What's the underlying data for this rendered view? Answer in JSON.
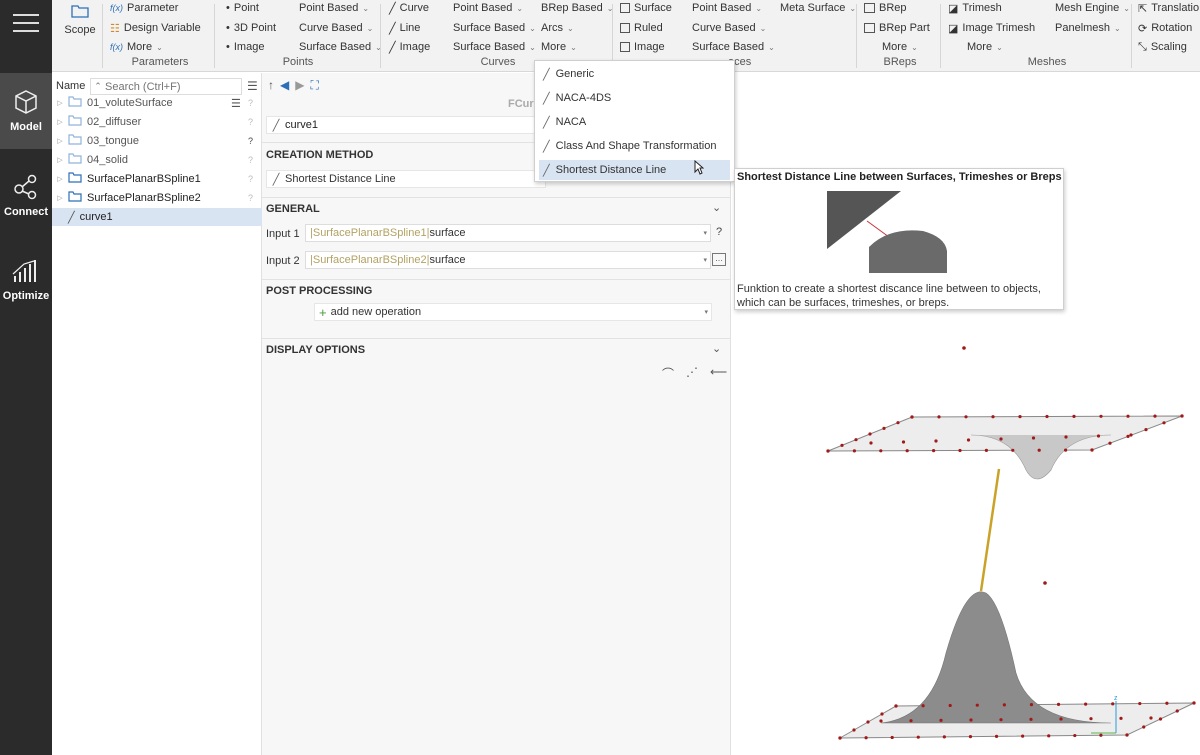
{
  "rail": {
    "items": [
      {
        "label": "Model",
        "icon": "cube-icon",
        "active": true
      },
      {
        "label": "Connect",
        "icon": "share-nodes-icon"
      },
      {
        "label": "Optimize",
        "icon": "bar-chart-icon"
      }
    ]
  },
  "ribbon": {
    "scope": "Scope",
    "parameters": {
      "items": [
        "Parameter",
        "Design Variable",
        "More"
      ],
      "group": "Parameters"
    },
    "points": {
      "col1": [
        "Point",
        "3D Point",
        "Image"
      ],
      "col2": [
        "Point Based",
        "Curve Based",
        "Surface Based"
      ],
      "group": "Points"
    },
    "curves": {
      "col1": [
        "Curve",
        "Line",
        "Image"
      ],
      "col2": [
        "Point Based",
        "Surface Based",
        "Surface Based"
      ],
      "col3": [
        "BRep Based",
        "Arcs",
        "More"
      ],
      "group": "Curves"
    },
    "surfaces": {
      "col1": [
        "Surface",
        "Ruled",
        "Image"
      ],
      "col2": [
        "Point Based",
        "Curve Based",
        "Surface Based"
      ],
      "col3": [
        "Meta Surface"
      ],
      "group": "aces"
    },
    "breps": {
      "items": [
        "BRep",
        "BRep Part",
        "More"
      ],
      "group": "BReps"
    },
    "meshes": {
      "col1": [
        "Trimesh",
        "Image Trimesh",
        "More"
      ],
      "col2": [
        "Mesh Engine",
        "Panelmesh"
      ],
      "group": "Meshes"
    },
    "transforms": {
      "items": [
        "Translatio",
        "Rotation",
        "Scaling"
      ]
    }
  },
  "tree": {
    "column": "Name",
    "search_placeholder": "Search (Ctrl+F)",
    "items": [
      {
        "label": "01_voluteSurface",
        "type": "folder"
      },
      {
        "label": "02_diffuser",
        "type": "folder"
      },
      {
        "label": "03_tongue",
        "type": "folder"
      },
      {
        "label": "04_solid",
        "type": "folder"
      },
      {
        "label": "SurfacePlanarBSpline1",
        "type": "folder-dark"
      },
      {
        "label": "SurfacePlanarBSpline2",
        "type": "folder-dark"
      },
      {
        "label": "curve1",
        "type": "curve",
        "selected": true
      }
    ]
  },
  "editor": {
    "type_label": "FCur",
    "name_value": "curve1",
    "creation_method_title": "CREATION METHOD",
    "creation_method_value": "Shortest Distance Line",
    "general_title": "GENERAL",
    "input1_label": "Input 1",
    "input1_ref": "|SurfacePlanarBSpline1|",
    "input1_val": "surface",
    "input2_label": "Input 2",
    "input2_ref": "|SurfacePlanarBSpline2|",
    "input2_val": "surface",
    "post_title": "POST PROCESSING",
    "add_operation": "add new operation",
    "display_title": "DISPLAY OPTIONS"
  },
  "menu": {
    "items": [
      "Generic",
      "NACA-4DS",
      "NACA",
      "Class And Shape Transformation",
      "Shortest Distance Line"
    ],
    "hovered": 4
  },
  "tooltip": {
    "title": "Shortest Distance Line between Surfaces, Trimeshes or Breps",
    "description": "Funktion to create a shortest discance line between to objects, which can be surfaces, trimeshes, or breps."
  },
  "colors": {
    "accent": "#2c6fb7",
    "rail": "#2b2b2b",
    "selection": "#d9e4f2",
    "curve": "#c9a227",
    "control_point": "#a11a1a"
  }
}
